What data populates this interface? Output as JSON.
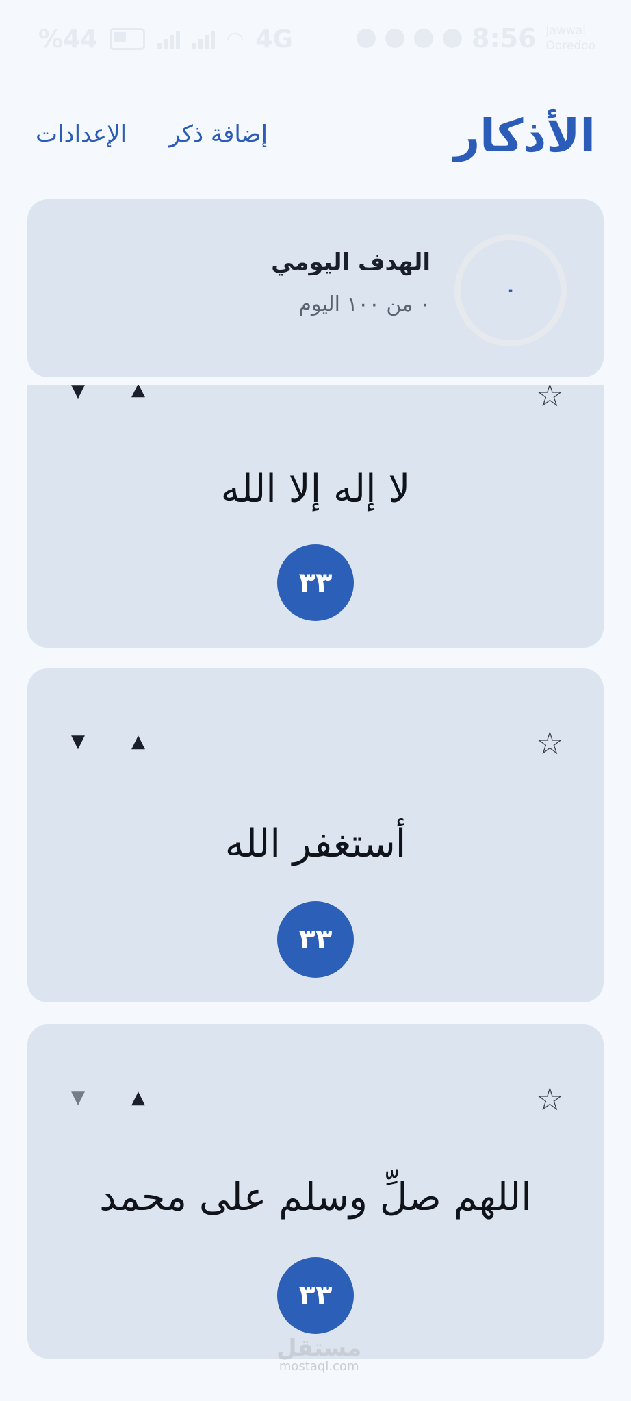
{
  "status_bar": {
    "battery_percent": "%44",
    "network": "4G",
    "time": "8:56",
    "carrier_line1": "Jawwal",
    "carrier_line2": "Ooredoo"
  },
  "header": {
    "title": "الأذكار",
    "nav": {
      "add_label": "إضافة ذكر",
      "settings_label": "الإعدادات"
    }
  },
  "daily_goal": {
    "title": "الهدف اليومي",
    "subtitle": "٠ من ١٠٠ اليوم",
    "progress_value": "٠",
    "progress_fraction": 0
  },
  "thikrs": [
    {
      "text": "لا إله إلا الله",
      "count": "٣٣",
      "star": "☆",
      "up": "▲",
      "down": "▼"
    },
    {
      "text": "أستغفر الله",
      "count": "٣٣",
      "star": "☆",
      "up": "▲",
      "down": "▼"
    },
    {
      "text": "اللهم صلِّ وسلم على محمد",
      "count": "٣٣",
      "star": "☆",
      "up": "▲",
      "down": "▼"
    }
  ],
  "watermark": {
    "arabic": "مستقل",
    "latin": "mostaql.com"
  },
  "colors": {
    "accent": "#2b5db8",
    "card": "#dce4ef",
    "background": "#f5f8fc"
  }
}
